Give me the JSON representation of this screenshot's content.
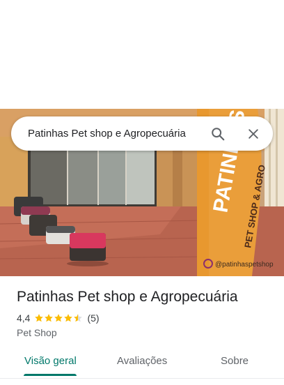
{
  "search": {
    "query": "Patinhas Pet shop e Agropecuária",
    "search_icon": "search-icon",
    "close_icon": "close-icon"
  },
  "photo": {
    "banner_text": "PATINHAS",
    "banner_subtext": "PET SHOP & AGRO",
    "banner_handle": "@patinhaspetshop"
  },
  "place": {
    "name": "Patinhas Pet shop e Agropecuária",
    "rating": "4,4",
    "rating_value": 4.4,
    "review_count": "(5)",
    "category": "Pet Shop"
  },
  "tabs": [
    {
      "label": "Visão geral",
      "active": true
    },
    {
      "label": "Avaliações",
      "active": false
    },
    {
      "label": "Sobre",
      "active": false
    }
  ],
  "colors": {
    "accent": "#00786a",
    "star": "#fbbc04",
    "banner": "#e8982f"
  }
}
